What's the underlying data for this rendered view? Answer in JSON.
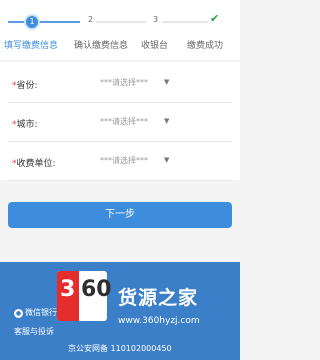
{
  "steps": [
    {
      "num": "1",
      "label": "填写缴费信息",
      "state": "active"
    },
    {
      "num": "2",
      "label": "确认缴费信息",
      "state": "pending"
    },
    {
      "num": "3",
      "label": "收银台",
      "state": "pending"
    },
    {
      "num": "✔",
      "label": "缴费成功",
      "state": "done-icon"
    }
  ],
  "form": {
    "province": {
      "required_mark": "*",
      "label": "省份:",
      "placeholder": "***请选择***"
    },
    "city": {
      "required_mark": "*",
      "label": "城市:",
      "placeholder": "***请选择***"
    },
    "unit": {
      "required_mark": "*",
      "label": "收费单位:",
      "placeholder": "***请选择***"
    }
  },
  "next_button": "下一步",
  "footer": {
    "wechat_text": "微信银行",
    "service_text": "客服与投诉",
    "icp": "京公安网备 110102000450"
  },
  "watermark": {
    "logo_text": "360",
    "title": "货源之家",
    "url": "www.360hyzj.com"
  },
  "colors": {
    "primary": "#3e8ddd",
    "footer": "#3c7fc9",
    "required": "#e23c3c",
    "success": "#2aa24c"
  }
}
